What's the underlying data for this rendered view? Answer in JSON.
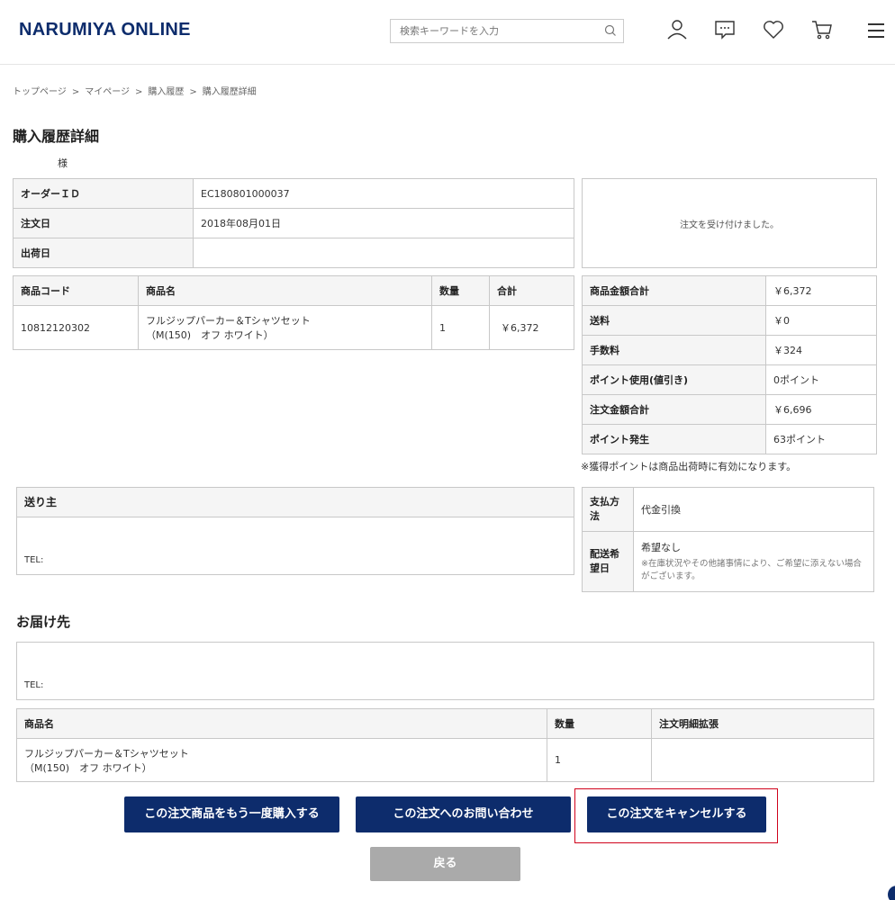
{
  "header": {
    "logo": "NARUMIYA ONLINE",
    "search_placeholder": "検索キーワードを入力",
    "icons": [
      "search-icon",
      "user-icon",
      "message-icon",
      "heart-icon",
      "cart-icon",
      "menu-icon"
    ]
  },
  "breadcrumb": [
    "トップページ",
    "マイページ",
    "購入履歴",
    "購入履歴詳細"
  ],
  "breadcrumb_sep": ">",
  "page_title": "購入履歴詳細",
  "customer_suffix": "様",
  "order_info": {
    "order_id_label": "オーダーＩＤ",
    "order_id": "EC180801000037",
    "order_date_label": "注文日",
    "order_date": "2018年08月01日",
    "ship_date_label": "出荷日",
    "ship_date": ""
  },
  "status_message": "注文を受け付けました。",
  "items_table": {
    "headers": [
      "商品コード",
      "商品名",
      "数量",
      "合計"
    ],
    "rows": [
      {
        "code": "10812120302",
        "name_line1": "フルジップパーカー＆Tシャツセット",
        "name_line2": "（M(150)　オフ ホワイト）",
        "qty": "1",
        "total": "￥6,372"
      }
    ]
  },
  "summary": {
    "rows": [
      {
        "label": "商品金額合計",
        "value": "￥6,372"
      },
      {
        "label": "送料",
        "value": "￥0"
      },
      {
        "label": "手数料",
        "value": "￥324"
      },
      {
        "label": "ポイント使用(値引き)",
        "value": "0ポイント"
      },
      {
        "label": "注文金額合計",
        "value": "￥6,696"
      },
      {
        "label": "ポイント発生",
        "value": "63ポイント"
      }
    ],
    "note": "※獲得ポイントは商品出荷時に有効になります。"
  },
  "sender": {
    "label": "送り主",
    "tel_label": "TEL:"
  },
  "payment": {
    "method_label": "支払方法",
    "method_value": "代金引換",
    "delivery_label": "配送希望日",
    "delivery_value": "希望なし",
    "delivery_note": "※在庫状況やその他諸事情により、ご希望に添えない場合がございます。"
  },
  "delivery": {
    "title": "お届け先",
    "tel_label": "TEL:",
    "table_headers": [
      "商品名",
      "数量",
      "注文明細拡張"
    ],
    "rows": [
      {
        "name_line1": "フルジップパーカー＆Tシャツセット",
        "name_line2": "（M(150)　オフ ホワイト）",
        "qty": "1",
        "ext": ""
      }
    ]
  },
  "buttons": {
    "reorder": "この注文商品をもう一度購入する",
    "inquiry": "この注文へのお問い合わせ",
    "cancel": "この注文をキャンセルする",
    "back": "戻る"
  },
  "colors": {
    "brand": "#0d2c6c",
    "highlight": "#d0021b",
    "back_button": "#aaaaaa"
  }
}
